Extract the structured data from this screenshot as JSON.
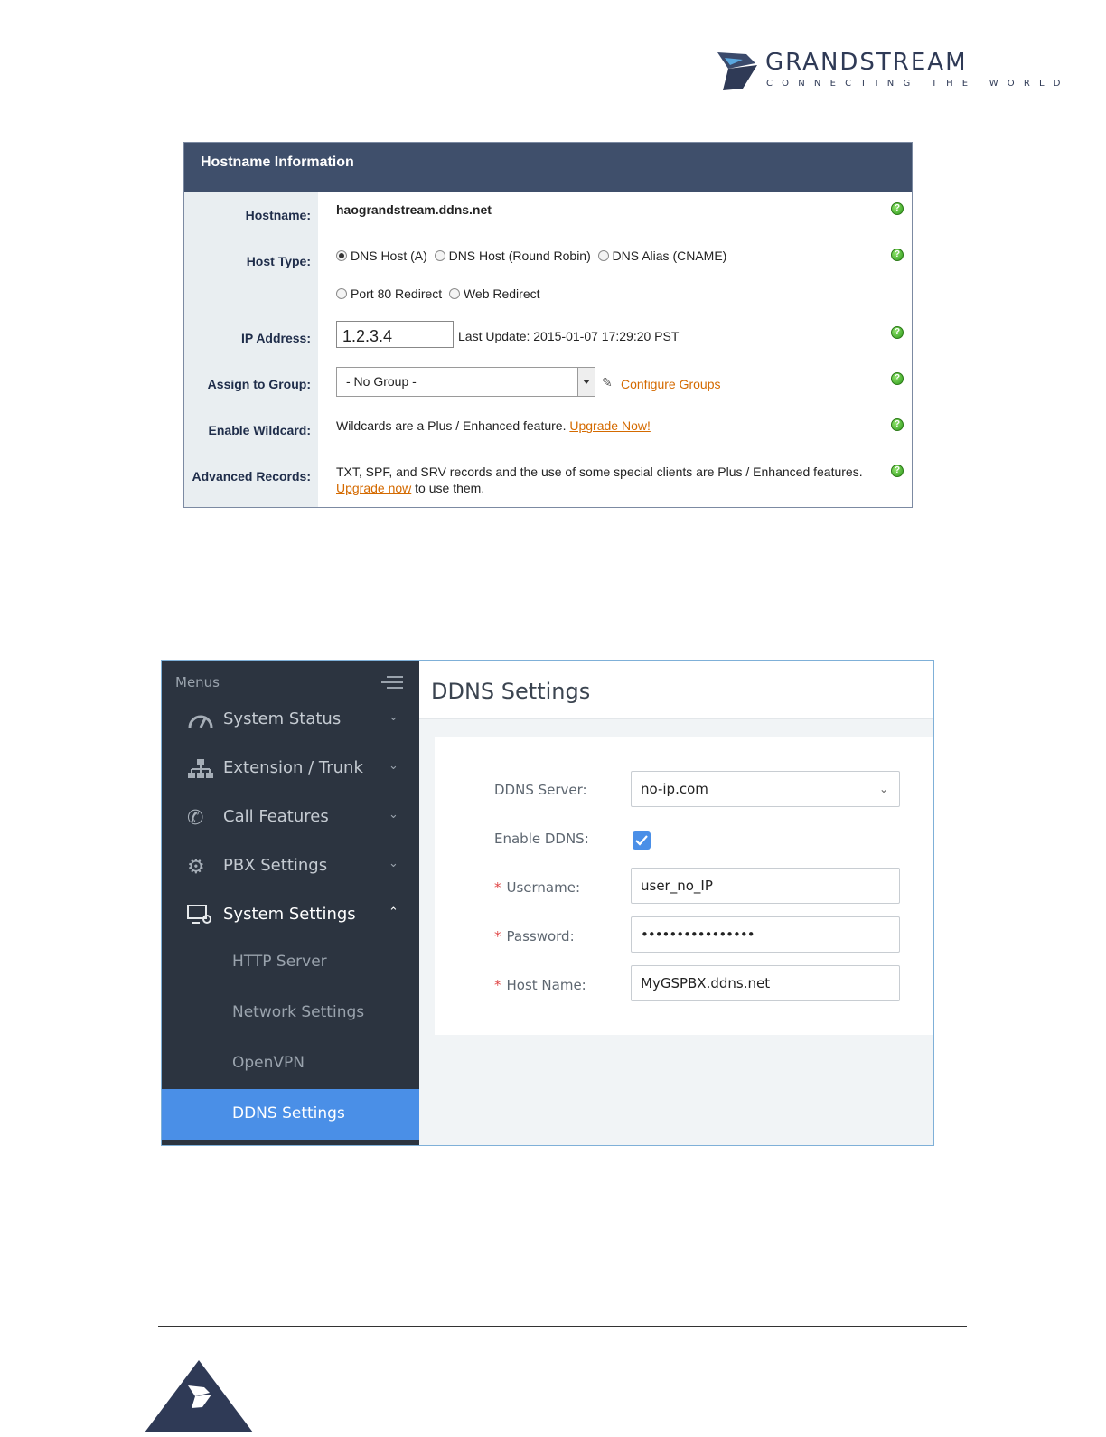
{
  "brand": {
    "name": "GRANDSTREAM",
    "tagline": "CONNECTING THE WORLD",
    "color": "#2f3a56"
  },
  "hostname_panel": {
    "title": "Hostname Information",
    "rows": {
      "hostname": {
        "label": "Hostname:",
        "value": "haograndstream.ddns.net"
      },
      "host_type": {
        "label": "Host Type:",
        "options": [
          "DNS Host (A)",
          "DNS Host (Round Robin)",
          "DNS Alias (CNAME)",
          "Port 80 Redirect",
          "Web Redirect"
        ],
        "selected": "DNS Host (A)"
      },
      "ip_address": {
        "label": "IP Address:",
        "value": "1.2.3.4",
        "last_update": "Last Update: 2015-01-07 17:29:20 PST"
      },
      "assign_group": {
        "label": "Assign to Group:",
        "selected": "- No Group -",
        "link": "Configure Groups"
      },
      "wildcard": {
        "label": "Enable Wildcard:",
        "text": "Wildcards are a Plus / Enhanced feature.",
        "link": "Upgrade Now!"
      },
      "advanced": {
        "label": "Advanced Records:",
        "text": "TXT, SPF, and SRV records and the use of some special clients are Plus / Enhanced features.",
        "link": "Upgrade now",
        "text_after": "to use them."
      }
    },
    "help_icon": "?"
  },
  "ddns_ui": {
    "sidebar": {
      "header": "Menus",
      "items": [
        {
          "label": "System Status",
          "icon": "gauge-icon",
          "chevron": "⌄"
        },
        {
          "label": "Extension / Trunk",
          "icon": "network-icon",
          "chevron": "⌄"
        },
        {
          "label": "Call Features",
          "icon": "phone-icon",
          "chevron": "⌄"
        },
        {
          "label": "PBX Settings",
          "icon": "gear-icon",
          "chevron": "⌄"
        },
        {
          "label": "System Settings",
          "icon": "monitor-gear-icon",
          "chevron": "⌃"
        }
      ],
      "subitems": [
        "HTTP Server",
        "Network Settings",
        "OpenVPN",
        "DDNS Settings"
      ],
      "active_subitem": "DDNS Settings"
    },
    "page_title": "DDNS Settings",
    "form": {
      "ddns_server": {
        "label": "DDNS Server:",
        "value": "no-ip.com"
      },
      "enable_ddns": {
        "label": "Enable DDNS:",
        "checked": true
      },
      "username": {
        "label": "Username:",
        "value": "user_no_IP"
      },
      "password": {
        "label": "Password:",
        "value": "••••••••••••••••"
      },
      "host_name": {
        "label": "Host Name:",
        "value": "MyGSPBX.ddns.net"
      },
      "required_mark": "*"
    },
    "colors": {
      "sidebar": "#2c3440",
      "active": "#4a8fe7"
    }
  }
}
